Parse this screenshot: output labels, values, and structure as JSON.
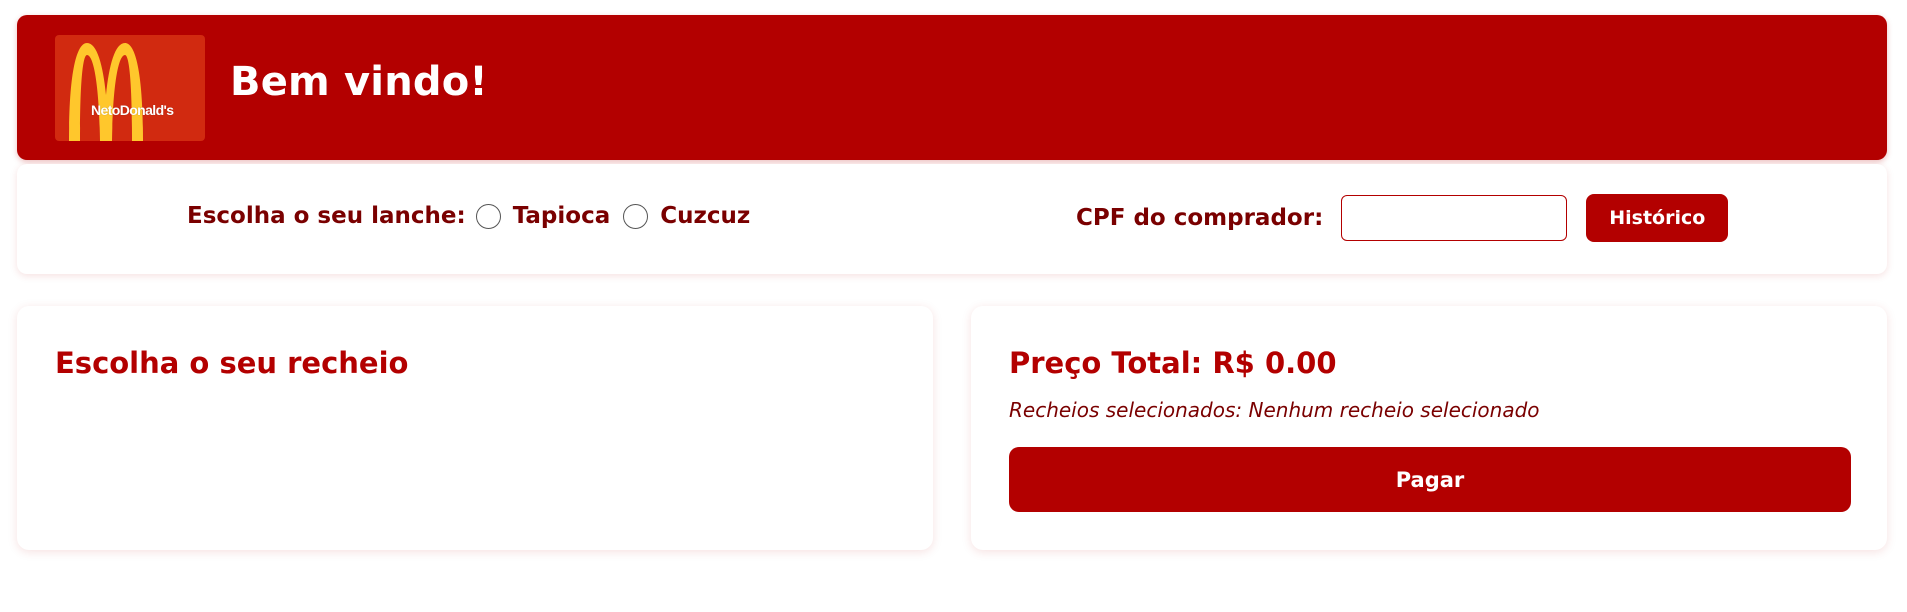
{
  "colors": {
    "brand_red": "#b30000",
    "text_dark_red": "#7a0000",
    "logo_bg": "#d12a10",
    "logo_arches": "#ffc72c"
  },
  "header": {
    "logo_text": "NetoDonald's",
    "welcome": "Bem vindo!"
  },
  "order_form": {
    "snack_label": "Escolha o seu lanche:",
    "snack_options": [
      "Tapioca",
      "Cuzcuz"
    ],
    "cpf_label": "CPF do comprador:",
    "cpf_value": "",
    "history_button": "Histórico"
  },
  "fillings_panel": {
    "title": "Escolha o seu recheio"
  },
  "summary_panel": {
    "total_label": "Preço Total: R$ 0.00",
    "selected_fillings": "Recheios selecionados: Nenhum recheio selecionado",
    "pay_button": "Pagar"
  }
}
